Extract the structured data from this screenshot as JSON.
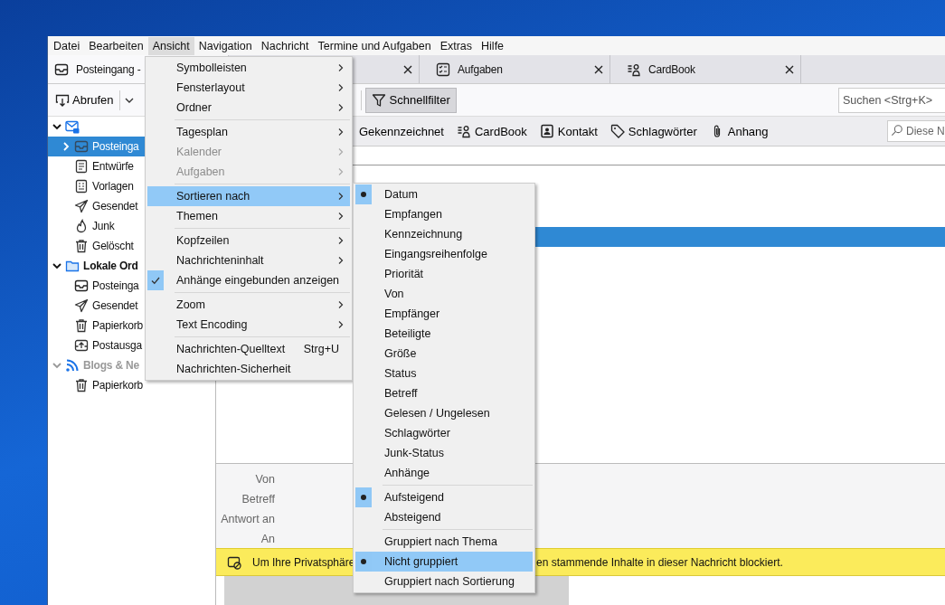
{
  "menubar": [
    {
      "label": "Datei",
      "selected": false
    },
    {
      "label": "Bearbeiten",
      "selected": false
    },
    {
      "label": "Ansicht",
      "selected": true
    },
    {
      "label": "Navigation",
      "selected": false
    },
    {
      "label": "Nachricht",
      "selected": false
    },
    {
      "label": "Termine und Aufgaben",
      "selected": false
    },
    {
      "label": "Extras",
      "selected": false
    },
    {
      "label": "Hilfe",
      "selected": false
    }
  ],
  "tabs": [
    {
      "label": "Posteingang -",
      "kind": "inbox",
      "selected": true
    },
    {
      "kind": "blank",
      "selected": false
    },
    {
      "label": "Aufgaben",
      "kind": "tasks",
      "selected": false
    },
    {
      "label": "CardBook",
      "kind": "cardbook",
      "selected": false
    }
  ],
  "toolbar": {
    "get_messages": "Abrufen",
    "quick_filter": {
      "label": "Schnellfilter",
      "on": true
    },
    "search": {
      "placeholder": "Suchen <Strg+K>"
    }
  },
  "accounts": [
    {
      "kind": "account",
      "expanded": true,
      "dimmed": false,
      "children": [
        {
          "label": "Posteinga",
          "kind": "inbox",
          "collapsed": true,
          "selected": true
        },
        {
          "label": "Entwürfe",
          "kind": "drafts",
          "collapsed": false,
          "selected": false
        },
        {
          "label": "Vorlagen",
          "kind": "templates",
          "collapsed": false,
          "selected": false
        },
        {
          "label": "Gesendet",
          "kind": "sent",
          "collapsed": false,
          "selected": false
        },
        {
          "label": "Junk",
          "kind": "junk",
          "collapsed": false,
          "selected": false
        },
        {
          "label": "Gelöscht",
          "kind": "trash",
          "collapsed": false,
          "selected": false
        }
      ]
    },
    {
      "label": "Lokale Ord",
      "kind": "folder",
      "expanded": true,
      "dimmed": false,
      "children": [
        {
          "label": "Posteinga",
          "kind": "inbox",
          "collapsed": false,
          "selected": false
        },
        {
          "label": "Gesendet",
          "kind": "sent",
          "collapsed": false,
          "selected": false
        },
        {
          "label": "Papierkorb",
          "kind": "trash",
          "collapsed": false,
          "selected": false
        },
        {
          "label": "Postausga",
          "kind": "outbox",
          "collapsed": false,
          "selected": false
        }
      ]
    },
    {
      "label": "Blogs & Ne",
      "kind": "rss",
      "expanded": true,
      "dimmed": true,
      "children": [
        {
          "label": "Papierkorb",
          "kind": "trash",
          "collapsed": false,
          "selected": false
        }
      ]
    }
  ],
  "quick_filters": [
    {
      "label": "Gekennzeichnet",
      "kind": "plain"
    },
    {
      "label": "CardBook",
      "kind": "cardbook"
    },
    {
      "label": "Kontakt",
      "kind": "contact"
    },
    {
      "label": "Schlagwörter",
      "kind": "tag"
    },
    {
      "label": "Anhang",
      "kind": "clip"
    }
  ],
  "filter_search": {
    "placeholder": "Diese N"
  },
  "message_list": {
    "rows": [
      {
        "selected": false
      },
      {
        "selected": false
      },
      {
        "selected": false
      },
      {
        "selected": true
      }
    ]
  },
  "header_fields": [
    "Von",
    "Betreff",
    "Antwort an",
    "An"
  ],
  "notification": {
    "text_start": "Um Ihre Privatsphäre",
    "text_end": "en stammende Inhalte in dieser Nachricht blockiert."
  },
  "view_menu": [
    {
      "kind": "item",
      "label": "Symbolleisten",
      "submenu": true,
      "disabled": false,
      "checked": false,
      "selected": false
    },
    {
      "kind": "item",
      "label": "Fensterlayout",
      "submenu": true,
      "disabled": false,
      "checked": false,
      "selected": false
    },
    {
      "kind": "item",
      "label": "Ordner",
      "submenu": true,
      "disabled": false,
      "checked": false,
      "selected": false
    },
    {
      "kind": "separator"
    },
    {
      "kind": "item",
      "label": "Tagesplan",
      "submenu": true,
      "disabled": false,
      "checked": false,
      "selected": false
    },
    {
      "kind": "item",
      "label": "Kalender",
      "submenu": true,
      "disabled": true,
      "checked": false,
      "selected": false
    },
    {
      "kind": "item",
      "label": "Aufgaben",
      "submenu": true,
      "disabled": true,
      "checked": false,
      "selected": false
    },
    {
      "kind": "separator"
    },
    {
      "kind": "item",
      "label": "Sortieren nach",
      "submenu": true,
      "disabled": false,
      "checked": false,
      "selected": true
    },
    {
      "kind": "item",
      "label": "Themen",
      "submenu": true,
      "disabled": false,
      "checked": false,
      "selected": false
    },
    {
      "kind": "separator"
    },
    {
      "kind": "item",
      "label": "Kopfzeilen",
      "submenu": true,
      "disabled": false,
      "checked": false,
      "selected": false
    },
    {
      "kind": "item",
      "label": "Nachrichteninhalt",
      "submenu": true,
      "disabled": false,
      "checked": false,
      "selected": false
    },
    {
      "kind": "item",
      "label": "Anhänge eingebunden anzeigen",
      "submenu": false,
      "disabled": false,
      "checked": true,
      "selected": false
    },
    {
      "kind": "separator"
    },
    {
      "kind": "item",
      "label": "Zoom",
      "submenu": true,
      "disabled": false,
      "checked": false,
      "selected": false
    },
    {
      "kind": "item",
      "label": "Text Encoding",
      "submenu": true,
      "disabled": false,
      "checked": false,
      "selected": false
    },
    {
      "kind": "separator"
    },
    {
      "kind": "item",
      "label": "Nachrichten-Quelltext",
      "shortcut": "Strg+U",
      "submenu": false,
      "disabled": false,
      "checked": false,
      "selected": false
    },
    {
      "kind": "item",
      "label": "Nachrichten-Sicherheit",
      "submenu": false,
      "disabled": false,
      "checked": false,
      "selected": false
    }
  ],
  "sort_menu": [
    {
      "kind": "radio",
      "label": "Datum",
      "checked": true,
      "selected": false
    },
    {
      "kind": "radio",
      "label": "Empfangen",
      "checked": false,
      "selected": false
    },
    {
      "kind": "radio",
      "label": "Kennzeichnung",
      "checked": false,
      "selected": false
    },
    {
      "kind": "radio",
      "label": "Eingangsreihenfolge",
      "checked": false,
      "selected": false
    },
    {
      "kind": "radio",
      "label": "Priorität",
      "checked": false,
      "selected": false
    },
    {
      "kind": "radio",
      "label": "Von",
      "checked": false,
      "selected": false
    },
    {
      "kind": "radio",
      "label": "Empfänger",
      "checked": false,
      "selected": false
    },
    {
      "kind": "radio",
      "label": "Beteiligte",
      "checked": false,
      "selected": false
    },
    {
      "kind": "radio",
      "label": "Größe",
      "checked": false,
      "selected": false
    },
    {
      "kind": "radio",
      "label": "Status",
      "checked": false,
      "selected": false
    },
    {
      "kind": "radio",
      "label": "Betreff",
      "checked": false,
      "selected": false
    },
    {
      "kind": "radio",
      "label": "Gelesen / Ungelesen",
      "checked": false,
      "selected": false
    },
    {
      "kind": "radio",
      "label": "Schlagwörter",
      "checked": false,
      "selected": false
    },
    {
      "kind": "radio",
      "label": "Junk-Status",
      "checked": false,
      "selected": false
    },
    {
      "kind": "radio",
      "label": "Anhänge",
      "checked": false,
      "selected": false
    },
    {
      "kind": "separator"
    },
    {
      "kind": "radio",
      "label": "Aufsteigend",
      "checked": true,
      "selected": false
    },
    {
      "kind": "radio",
      "label": "Absteigend",
      "checked": false,
      "selected": false
    },
    {
      "kind": "separator"
    },
    {
      "kind": "radio",
      "label": "Gruppiert nach Thema",
      "checked": false,
      "selected": false
    },
    {
      "kind": "radio",
      "label": "Nicht gruppiert",
      "checked": true,
      "selected": true
    },
    {
      "kind": "radio",
      "label": "Gruppiert nach Sortierung",
      "checked": false,
      "selected": false
    }
  ]
}
